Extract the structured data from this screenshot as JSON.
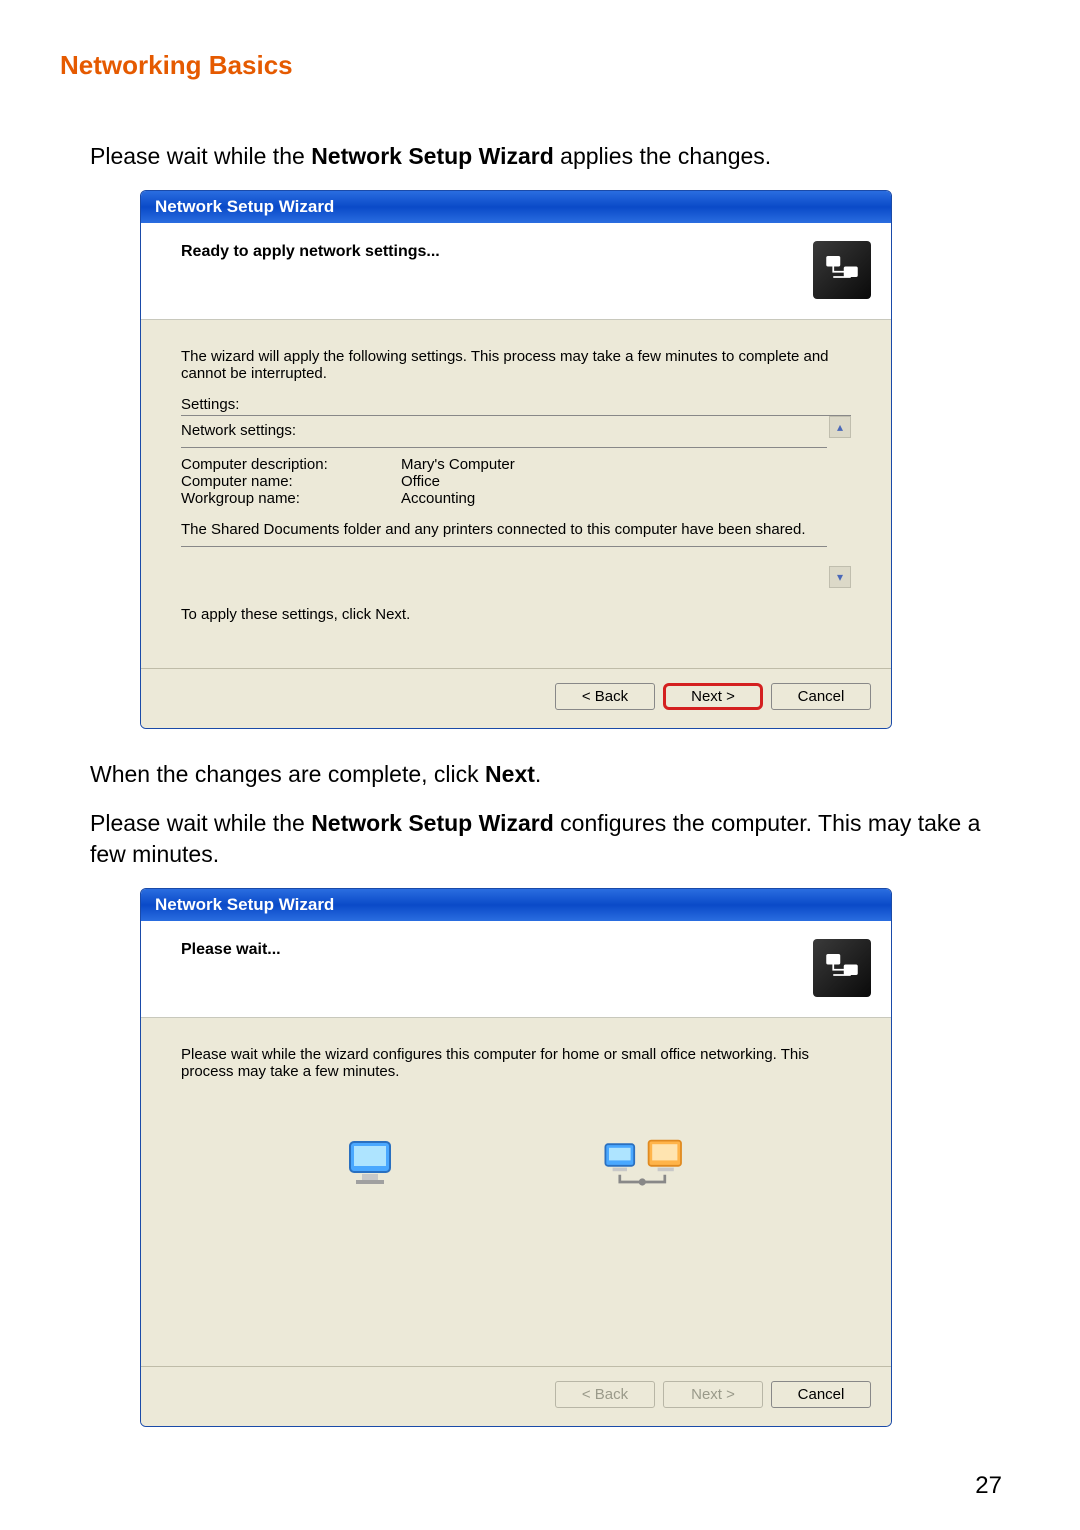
{
  "heading": "Networking Basics",
  "instr1_pre": "Please wait while the ",
  "instr1_bold": "Network Setup Wizard",
  "instr1_post": " applies the changes.",
  "wizard1": {
    "title": "Network Setup Wizard",
    "header": "Ready to apply network settings...",
    "body_intro": "The wizard will apply the following settings. This process may take a few minutes to complete and cannot be interrupted.",
    "settings_label": "Settings:",
    "settings_heading": "Network settings:",
    "rows": [
      {
        "k": "Computer description:",
        "v": "Mary's Computer"
      },
      {
        "k": "Computer name:",
        "v": "Office"
      },
      {
        "k": "Workgroup name:",
        "v": "Accounting"
      }
    ],
    "settings_note": "The Shared Documents folder and any printers connected to this computer have been shared.",
    "apply_note": "To apply these settings, click Next.",
    "buttons": {
      "back": "< Back",
      "next": "Next >",
      "cancel": "Cancel"
    }
  },
  "instr2_pre": "When the changes are complete, click ",
  "instr2_bold": "Next",
  "instr2_post": ".",
  "instr3_pre": "Please wait while the ",
  "instr3_bold": "Network Setup Wizard",
  "instr3_post": " configures the computer. This may take a few minutes.",
  "wizard2": {
    "title": "Network Setup Wizard",
    "header": "Please wait...",
    "body_intro": "Please wait while the wizard configures this computer for home or small office networking. This process may take a few minutes.",
    "buttons": {
      "back": "< Back",
      "next": "Next >",
      "cancel": "Cancel"
    }
  },
  "page_number": "27"
}
